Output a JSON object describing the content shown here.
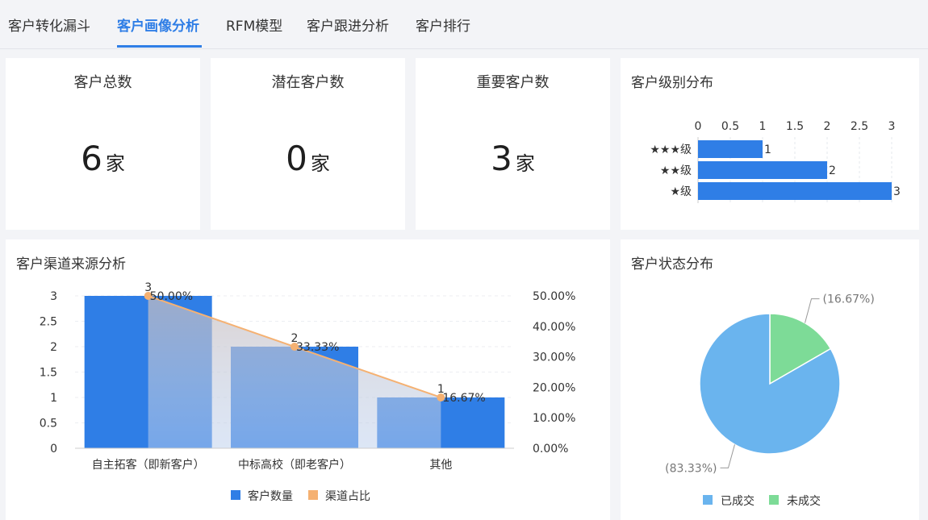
{
  "tabs": [
    {
      "label": "客户转化漏斗",
      "active": false
    },
    {
      "label": "客户画像分析",
      "active": true
    },
    {
      "label": "RFM模型",
      "active": false
    },
    {
      "label": "客户跟进分析",
      "active": false
    },
    {
      "label": "客户排行",
      "active": false
    }
  ],
  "stats": [
    {
      "title": "客户总数",
      "value": "6",
      "unit": "家"
    },
    {
      "title": "潜在客户数",
      "value": "0",
      "unit": "家"
    },
    {
      "title": "重要客户数",
      "value": "3",
      "unit": "家"
    }
  ],
  "colors": {
    "accent": "#2f7ee6",
    "bar_blue": "#2f7ee6",
    "line_orange": "#f5b172",
    "pie_blue": "#6ab4ee",
    "pie_green": "#7ddb97"
  },
  "chart_data": [
    {
      "type": "bar",
      "title": "客户级别分布",
      "orientation": "horizontal",
      "categories": [
        "★★★级",
        "★★级",
        "★级"
      ],
      "values": [
        1,
        2,
        3
      ],
      "xlim": [
        0,
        3
      ],
      "x_ticks": [
        "0",
        "0.5",
        "1",
        "1.5",
        "2",
        "2.5",
        "3"
      ],
      "axis_position": "top",
      "grid": true
    },
    {
      "type": "bar",
      "title": "客户渠道来源分析",
      "categories": [
        "自主拓客（即新客户）",
        "中标高校（即老客户）",
        "其他"
      ],
      "series": [
        {
          "name": "客户数量",
          "type": "bar",
          "values": [
            3,
            2,
            1
          ],
          "labels": [
            "3",
            "2",
            "1"
          ]
        },
        {
          "name": "渠道占比",
          "type": "line",
          "values": [
            50.0,
            33.33,
            16.67
          ],
          "labels": [
            "50.00%",
            "33.33%",
            "16.67%"
          ]
        }
      ],
      "y_left_ticks": [
        "0",
        "0.5",
        "1",
        "1.5",
        "2",
        "2.5",
        "3"
      ],
      "y_left_lim": [
        0,
        3
      ],
      "y_right_ticks": [
        "0.00%",
        "10.00%",
        "20.00%",
        "30.00%",
        "40.00%",
        "50.00%"
      ],
      "y_right_lim": [
        0,
        50
      ],
      "legend": "bottom-center",
      "grid": true
    },
    {
      "type": "pie",
      "title": "客户状态分布",
      "slices": [
        {
          "name": "已成交",
          "value": 83.33,
          "label": "(83.33%)"
        },
        {
          "name": "未成交",
          "value": 16.67,
          "label": "(16.67%)"
        }
      ],
      "legend": "bottom-center"
    }
  ]
}
